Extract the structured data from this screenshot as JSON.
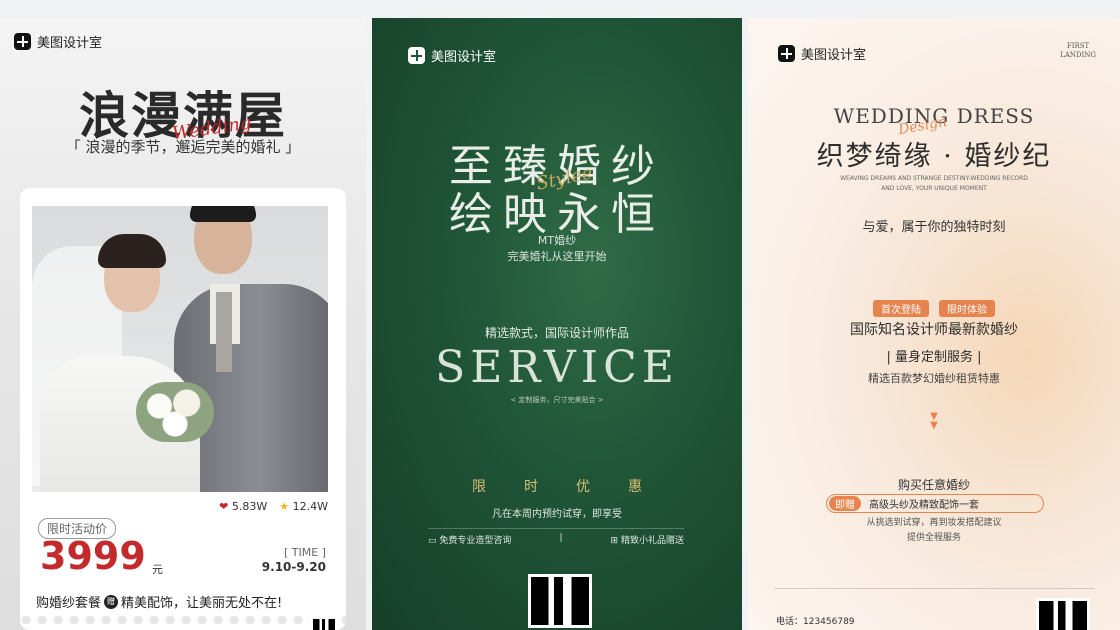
{
  "brand": {
    "logo_text": "美图设计室"
  },
  "card1": {
    "title": "浪漫满屋",
    "script": "Wedding",
    "subtitle": "「 浪漫的季节，邂逅完美的婚礼 」",
    "likes": "5.83W",
    "stars": "12.4W",
    "promo_label": "限时活动价",
    "price": "3999",
    "price_unit": "元",
    "time_label": "[ TIME ]",
    "time_range": "9.10-9.20",
    "bottom_text_a": "购婚纱套餐",
    "bottom_badge": "赠",
    "bottom_text_b": "精美配饰，让美丽无处不在!"
  },
  "card2": {
    "line1": "至臻婚纱",
    "line2": "绘映永恒",
    "script": "Stylee",
    "brand_line": "MT婚纱",
    "tagline": "完美婚礼从这里开始",
    "select_line": "精选款式，国际设计师作品",
    "service": "SERVICE",
    "service_small": "< 定制服务，尺寸完美贴合 >",
    "limit_chars": [
      "限",
      "时",
      "优",
      "惠"
    ],
    "limit_line": "凡在本周内预约试穿，即享受",
    "perk1": "免费专业造型咨询",
    "perk2": "精致小礼品赠送"
  },
  "card3": {
    "corner": "FIRST\nLANDING",
    "wedding_dress": "WEDDING DRESS",
    "script": "Design",
    "title": "织梦绮缘 · 婚纱纪",
    "english": "WEAVING DREAMS AND STRANGE DESTINY-WEDDING RECORD\nAND LOVE, YOUR UNIQUE MOMENT",
    "love_line": "与爱，属于你的独特时刻",
    "badge1": "首次登陆",
    "badge2": "限时体验",
    "intl": "国际知名设计师最新款婚纱",
    "bespoke": "| 量身定制服务 |",
    "select": "精选百款梦幻婚纱租赁特惠",
    "buy": "购买任意婚纱",
    "pill_tag": "即赠",
    "pill_text": "高级头纱及精致配饰一套",
    "note1": "从挑选到试穿，再到妆发搭配建议",
    "note2": "提供全程服务",
    "phone": "电话：123456789"
  },
  "colors": {
    "accent_red": "#c4292b",
    "deep_green": "#1f5437",
    "gold": "#d9bd74",
    "peach": "#e5844e"
  }
}
